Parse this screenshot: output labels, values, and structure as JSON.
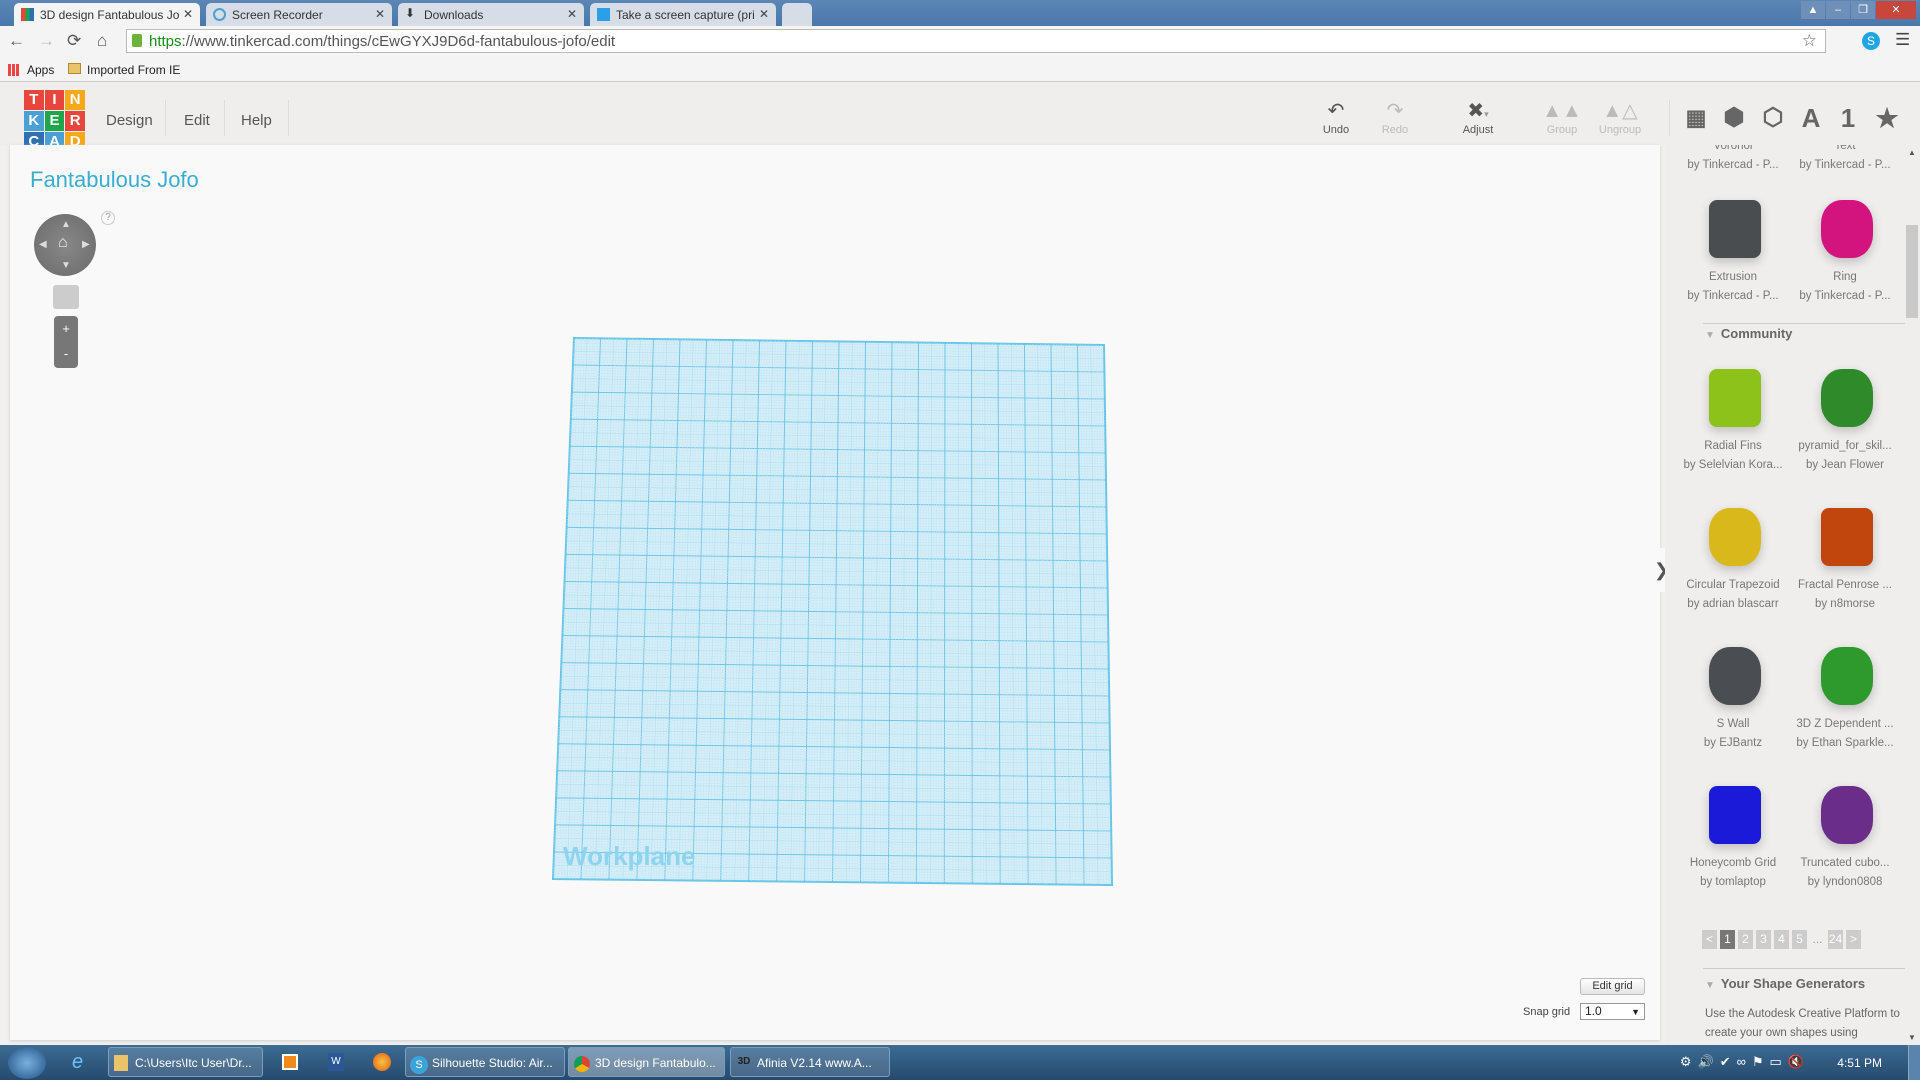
{
  "browser": {
    "tabs": [
      {
        "title": "3D design Fantabulous Jo",
        "active": true,
        "icon": "tinkercad-icon"
      },
      {
        "title": "Screen Recorder",
        "icon": "recorder-icon"
      },
      {
        "title": "Downloads",
        "icon": "download-icon"
      },
      {
        "title": "Take a screen capture (pri",
        "icon": "windows-icon"
      }
    ],
    "url_scheme": "https",
    "url_rest": "://www.tinkercad.com/things/cEwGYXJ9D6d-fantabulous-jofo/edit",
    "bookmarks": [
      "Apps",
      "Imported From IE"
    ]
  },
  "app": {
    "logo": [
      "T",
      "I",
      "N",
      "K",
      "E",
      "R",
      "C",
      "A",
      "D"
    ],
    "logo_colors": [
      "#e8463c",
      "#e8463c",
      "#f7a81b",
      "#4a9fd4",
      "#1fa64c",
      "#e8463c",
      "#2f6fb4",
      "#4a9fd4",
      "#f7a81b"
    ],
    "menu": [
      "Design",
      "Edit",
      "Help"
    ],
    "toolbar": [
      {
        "label": "Undo",
        "icon": "undo-icon",
        "enabled": true
      },
      {
        "label": "Redo",
        "icon": "redo-icon",
        "enabled": false
      },
      {
        "label": "Adjust",
        "icon": "adjust-icon",
        "enabled": true
      },
      {
        "label": "Group",
        "icon": "group-icon",
        "enabled": false
      },
      {
        "label": "Ungroup",
        "icon": "ungroup-icon",
        "enabled": false
      }
    ],
    "view_icons": [
      "workplane-icon",
      "box-icon",
      "wireframe-icon",
      "A",
      "1",
      "★"
    ],
    "design_title": "Fantabulous Jofo",
    "help_mark": "?",
    "zoom_in": "+",
    "zoom_out": "-",
    "workplane_label": "Workplane",
    "edit_grid": "Edit grid",
    "snap_grid_label": "Snap grid",
    "snap_grid_value": "1.0",
    "accent": "#3aaed0"
  },
  "panel": {
    "top_partial": [
      {
        "name": "Voronoi",
        "author": "by Tinkercad - P..."
      },
      {
        "name": "Text",
        "author": "by Tinkercad - P..."
      }
    ],
    "basic": [
      {
        "name": "Extrusion",
        "author": "by Tinkercad - P...",
        "color": "#4a4d50"
      },
      {
        "name": "Ring",
        "author": "by Tinkercad - P...",
        "color": "#d4147e"
      }
    ],
    "community_title": "Community",
    "community": [
      {
        "name": "Radial Fins",
        "author": "by Selelvian Kora...",
        "color": "#8cc21a"
      },
      {
        "name": "pyramid_for_skil...",
        "author": "by Jean Flower",
        "color": "#2f8a2a"
      },
      {
        "name": "Circular Trapezoid",
        "author": "by adrian blascarr",
        "color": "#d8b81a"
      },
      {
        "name": "Fractal Penrose ...",
        "author": "by n8morse",
        "color": "#c0460e"
      },
      {
        "name": "S Wall",
        "author": "by EJBantz",
        "color": "#4a4d52"
      },
      {
        "name": "3D Z Dependent ...",
        "author": "by Ethan Sparkle...",
        "color": "#2e9a2e"
      },
      {
        "name": "Honeycomb Grid",
        "author": "by tomlaptop",
        "color": "#1a1ad8"
      },
      {
        "name": "Truncated cubo...",
        "author": "by lyndon0808",
        "color": "#6a2e8a"
      }
    ],
    "pager": [
      "<",
      "1",
      "2",
      "3",
      "4",
      "5",
      "...",
      "24",
      ">"
    ],
    "pager_current": "1",
    "generators_title": "Your Shape Generators",
    "generators_text": "Use the Autodesk Creative Platform to create your own shapes using JavaScript. Publish ..."
  },
  "taskbar": {
    "items": [
      {
        "label": "C:\\Users\\Itc User\\Dr...",
        "icon": "folder-icon"
      },
      {
        "label": "Silhouette Studio: Air...",
        "icon": "silhouette-icon"
      },
      {
        "label": "3D design Fantabulo...",
        "icon": "chrome-icon",
        "active": true
      },
      {
        "label": "Afinia  V2.14  www.A...",
        "icon": "afinia-icon"
      }
    ],
    "clock": "4:51 PM"
  }
}
